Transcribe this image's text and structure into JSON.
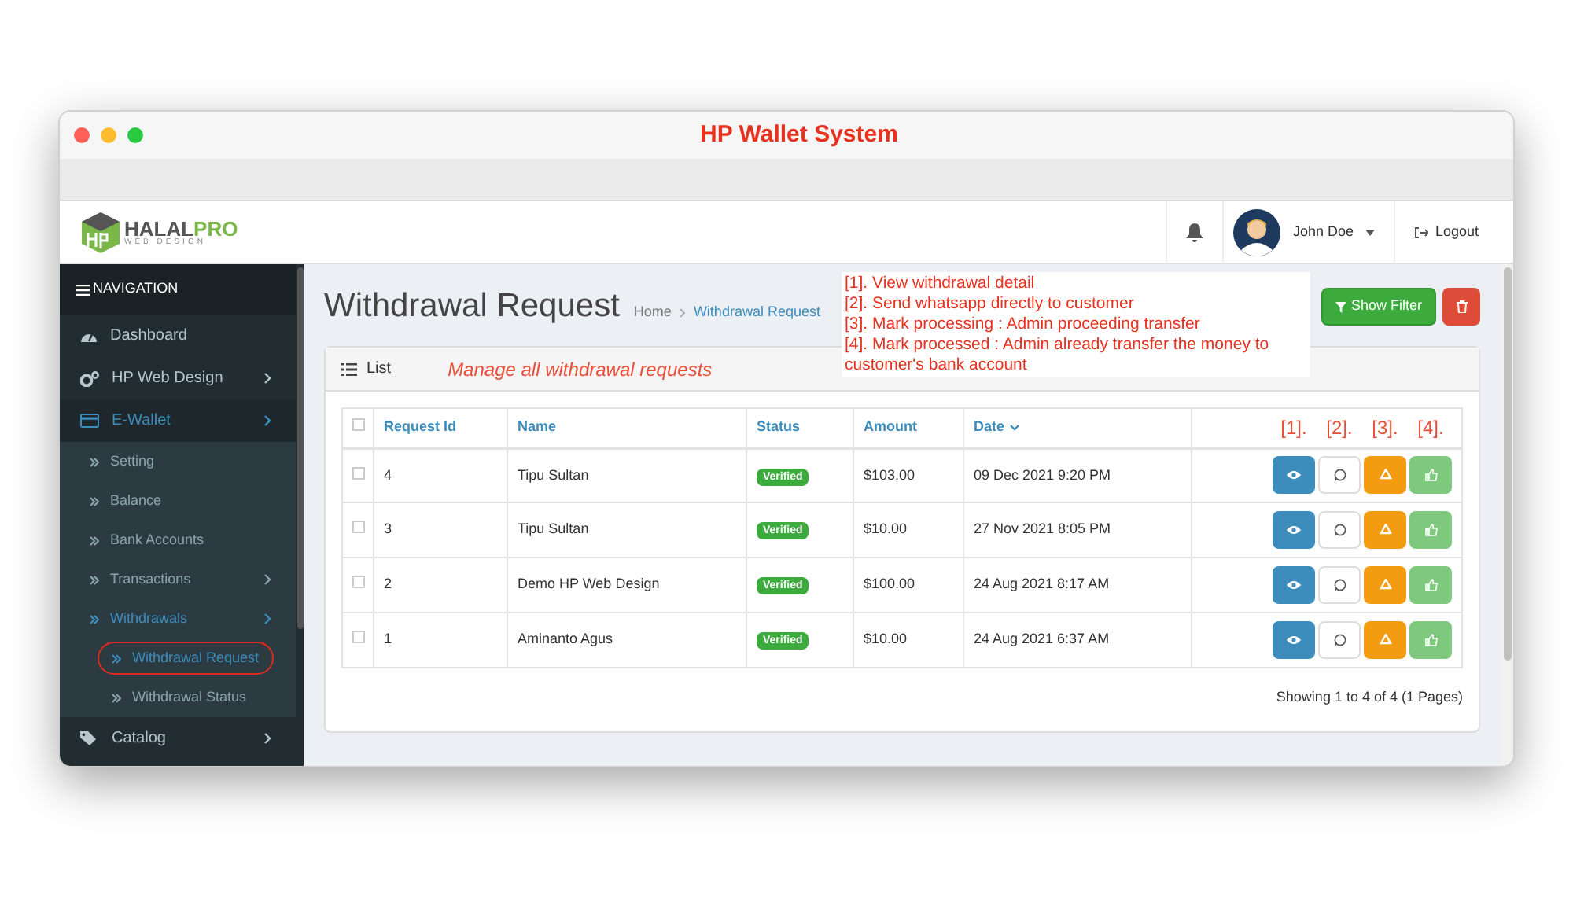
{
  "window": {
    "title": "HP Wallet System"
  },
  "logo": {
    "text_1": "HALAL",
    "text_2": "PRO",
    "tagline": "WEB DESIGN"
  },
  "header": {
    "user_name": "John Doe",
    "logout": "Logout"
  },
  "sidebar": {
    "heading": "NAVIGATION",
    "items": [
      {
        "label": "Dashboard",
        "selected": false,
        "has_arrow": false
      },
      {
        "label": "HP Web Design",
        "selected": false,
        "has_arrow": true
      },
      {
        "label": "E-Wallet",
        "selected": true,
        "has_arrow": true,
        "children": [
          {
            "label": "Setting",
            "selected": false,
            "has_arrow": false
          },
          {
            "label": "Balance",
            "selected": false,
            "has_arrow": false
          },
          {
            "label": "Bank Accounts",
            "selected": false,
            "has_arrow": false
          },
          {
            "label": "Transactions",
            "selected": false,
            "has_arrow": true
          },
          {
            "label": "Withdrawals",
            "selected": true,
            "has_arrow": true,
            "children": [
              {
                "label": "Withdrawal Request",
                "selected": true,
                "circled": true
              },
              {
                "label": "Withdrawal Status",
                "selected": false,
                "circled": false
              }
            ]
          }
        ]
      },
      {
        "label": "Catalog",
        "selected": false,
        "has_arrow": true
      }
    ]
  },
  "page": {
    "title": "Withdrawal Request",
    "breadcrumb": [
      "Home",
      "Withdrawal Request"
    ],
    "show_filter": "Show Filter"
  },
  "annotation": [
    "[1]. View withdrawal detail",
    "[2]. Send whatsapp directly to customer",
    "[3]. Mark processing : Admin proceeding transfer",
    "[4]. Mark processed : Admin already transfer the money to customer's  bank account"
  ],
  "panel": {
    "title": "List",
    "note": "Manage all withdrawal requests"
  },
  "table": {
    "all_checked": false,
    "columns": [
      {
        "label": "Request Id",
        "sorted": false
      },
      {
        "label": "Name",
        "sorted": false
      },
      {
        "label": "Status",
        "sorted": false
      },
      {
        "label": "Amount",
        "sorted": false
      },
      {
        "label": "Date",
        "sorted": true
      }
    ],
    "action_labels": [
      "[1].",
      "[2].",
      "[3].",
      "[4]."
    ],
    "rows": [
      {
        "checked": false,
        "id": "4",
        "name": "Tipu Sultan",
        "status": "Verified",
        "amount": "$103.00",
        "date": "09 Dec 2021 9:20 PM"
      },
      {
        "checked": false,
        "id": "3",
        "name": "Tipu Sultan",
        "status": "Verified",
        "amount": "$10.00",
        "date": "27 Nov 2021 8:05 PM"
      },
      {
        "checked": false,
        "id": "2",
        "name": "Demo HP Web Design",
        "status": "Verified",
        "amount": "$100.00",
        "date": "24 Aug 2021 8:17 AM"
      },
      {
        "checked": false,
        "id": "1",
        "name": "Aminanto Agus",
        "status": "Verified",
        "amount": "$10.00",
        "date": "24 Aug 2021 6:37 AM"
      }
    ],
    "footer": "Showing 1 to 4 of 4 (1 Pages)"
  }
}
